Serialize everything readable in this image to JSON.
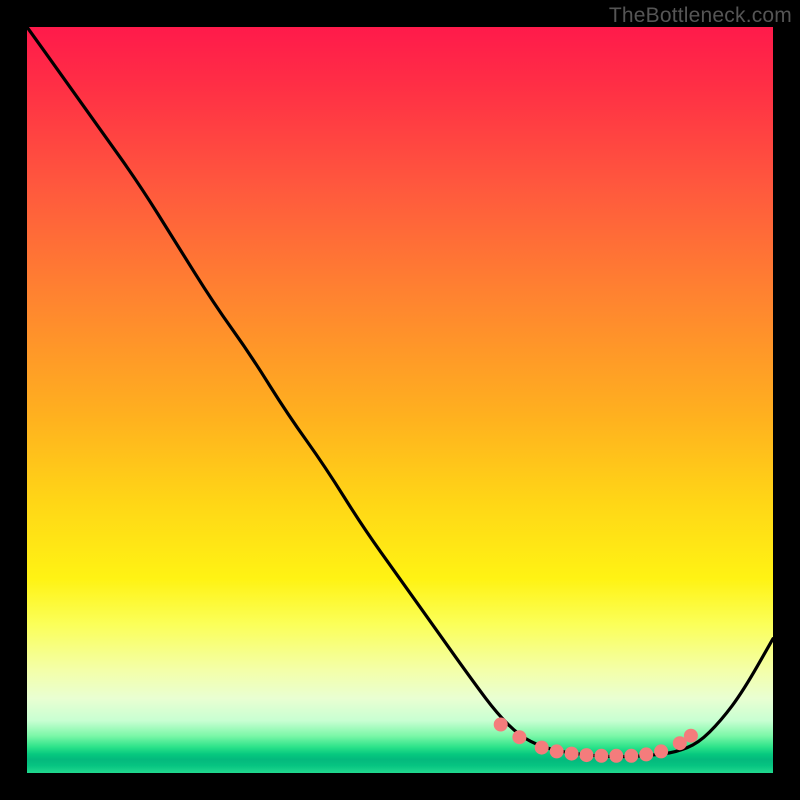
{
  "watermark": "TheBottleneck.com",
  "chart_data": {
    "type": "line",
    "title": "",
    "xlabel": "",
    "ylabel": "",
    "xlim": [
      0,
      100
    ],
    "ylim": [
      0,
      100
    ],
    "grid": false,
    "legend": false,
    "series": [
      {
        "name": "curve",
        "color": "#000000",
        "x": [
          0,
          5,
          10,
          15,
          20,
          25,
          30,
          35,
          40,
          45,
          50,
          55,
          60,
          63,
          66,
          69,
          72,
          75,
          78,
          81,
          84,
          87,
          90,
          93,
          96,
          100
        ],
        "y": [
          100,
          93,
          86,
          79,
          71,
          63,
          56,
          48,
          41,
          33,
          26,
          19,
          12,
          8,
          5,
          3.5,
          2.8,
          2.4,
          2.2,
          2.2,
          2.4,
          2.8,
          4,
          7,
          11,
          18
        ]
      }
    ],
    "markers": {
      "name": "highlight-points",
      "color": "#f47c7c",
      "radius": 7,
      "x": [
        63.5,
        66,
        69,
        71,
        73,
        75,
        77,
        79,
        81,
        83,
        85,
        87.5,
        89
      ],
      "y": [
        6.5,
        4.8,
        3.4,
        2.9,
        2.6,
        2.4,
        2.3,
        2.3,
        2.3,
        2.5,
        2.9,
        4.0,
        5.0
      ]
    }
  }
}
